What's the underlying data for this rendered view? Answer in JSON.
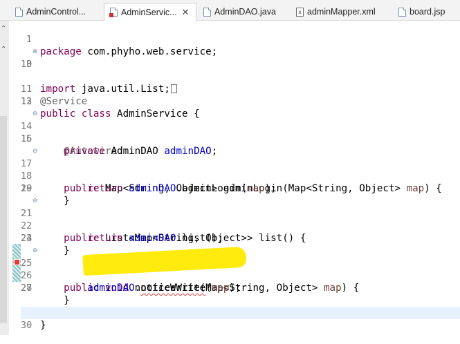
{
  "tabs": [
    {
      "label": "AdminControl...",
      "icon": "java-file-icon",
      "active": false
    },
    {
      "label": "AdminServic...",
      "icon": "java-file-error-icon",
      "active": true,
      "close": "✕"
    },
    {
      "label": "AdminDAO.java",
      "icon": "java-file-icon",
      "active": false
    },
    {
      "label": "adminMapper.xml",
      "icon": "xml-file-icon",
      "active": false
    },
    {
      "label": "board.jsp",
      "icon": "jsp-file-icon",
      "active": false
    }
  ],
  "editor": {
    "line_numbers": [
      "1",
      "3",
      "10",
      "11",
      "12",
      "13",
      "14",
      "15",
      "16",
      "17",
      "18",
      "19",
      "20",
      "21",
      "22",
      "23",
      "24",
      "25",
      "26",
      "27",
      "28",
      "29",
      "30"
    ],
    "code": {
      "l1_kw": "package",
      "l1_rest": " com.phyho.web.service;",
      "l3_kw": "import",
      "l3_rest": " java.util.List;",
      "l11_an": "@Service",
      "l12_kw1": "public",
      "l12_kw2": "class",
      "l12_rest": " AdminService {",
      "l14_an": "@Autowired",
      "l15_kw": "private",
      "l15_type": " AdminDAO ",
      "l15_fd": "adminDAO",
      "l15_end": ";",
      "l17_kw": "public",
      "l17_mid": " Map<String, Object> adminLogin(Map<String, Object> ",
      "l17_vr": "map",
      "l17_end": ") {",
      "l18_kw": "return",
      "l18_fd": "adminDAO",
      "l18_mid": ".adminLogin(",
      "l18_vr": "map",
      "l18_end": ");",
      "l19": "}",
      "l21_kw": "public",
      "l21_rest": " List<Map<String, Object>> list() {",
      "l22_kw": "return",
      "l22_fd": "adminDAO",
      "l22_rest": ".list();",
      "l23": "}",
      "l25_kw1": "public",
      "l25_kw2": "void",
      "l25_mid": " noticeWrite(Map<String, Object> ",
      "l25_vr": "map",
      "l25_end": ") {",
      "l26_fd": "adminDAO",
      "l26_dot": ".",
      "l26_err": "noticeWrite",
      "l26_open": "(",
      "l26_vr": "map",
      "l26_end": ");",
      "l27": "}",
      "l29": "}"
    }
  },
  "colors": {
    "keyword": "#7f0055",
    "annotation": "#646464",
    "field": "#0000c0",
    "local_variable": "#6a3e3e",
    "highlight": "#ffe600",
    "current_line": "#e8f2fe"
  }
}
